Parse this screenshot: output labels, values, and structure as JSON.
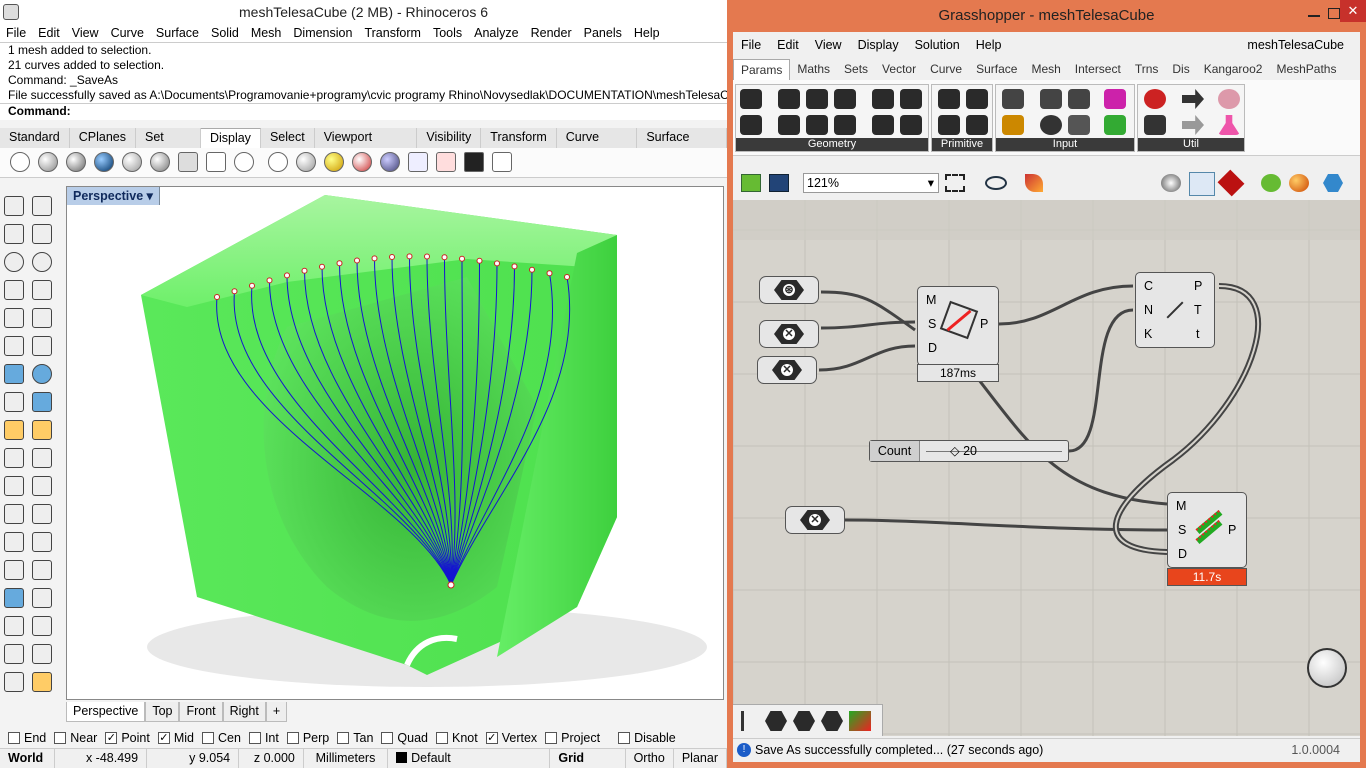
{
  "rhino": {
    "title": "meshTelesaCube (2 MB) - Rhinoceros 6",
    "menu": [
      "File",
      "Edit",
      "View",
      "Curve",
      "Surface",
      "Solid",
      "Mesh",
      "Dimension",
      "Transform",
      "Tools",
      "Analyze",
      "Render",
      "Panels",
      "Help"
    ],
    "command_history": [
      "1 mesh added to selection.",
      "21 curves added to selection.",
      "Command: _SaveAs",
      "File successfully saved as A:\\Documents\\Programovanie+programy\\cvic programy Rhino\\Novysedlak\\DOCUMENTATION\\meshTelesaCube"
    ],
    "command_prompt": "Command:",
    "tabs": [
      "Standard",
      "CPlanes",
      "Set View",
      "Display",
      "Select",
      "Viewport Layout",
      "Visibility",
      "Transform",
      "Curve Tools",
      "Surface Tools"
    ],
    "active_tab": "Display",
    "viewport_label": "Perspective",
    "viewport_tabs": [
      "Perspective",
      "Top",
      "Front",
      "Right"
    ],
    "viewport_add": "+",
    "osnaps": [
      {
        "label": "End",
        "checked": false
      },
      {
        "label": "Near",
        "checked": false
      },
      {
        "label": "Point",
        "checked": true
      },
      {
        "label": "Mid",
        "checked": true
      },
      {
        "label": "Cen",
        "checked": false
      },
      {
        "label": "Int",
        "checked": false
      },
      {
        "label": "Perp",
        "checked": false
      },
      {
        "label": "Tan",
        "checked": false
      },
      {
        "label": "Quad",
        "checked": false
      },
      {
        "label": "Knot",
        "checked": false
      },
      {
        "label": "Vertex",
        "checked": true
      },
      {
        "label": "Project",
        "checked": false
      },
      {
        "label": "Disable",
        "checked": false
      }
    ],
    "status": {
      "cplane": "World",
      "x": "x -48.499",
      "y": "y 9.054",
      "z": "z 0.000",
      "units": "Millimeters",
      "layer": "Default",
      "grid_snap": "Grid Snap",
      "ortho": "Ortho",
      "planar": "Planar"
    }
  },
  "grasshopper": {
    "title": "Grasshopper - meshTelesaCube",
    "menu": [
      "File",
      "Edit",
      "View",
      "Display",
      "Solution",
      "Help"
    ],
    "document_name": "meshTelesaCube",
    "tabs": [
      "Params",
      "Maths",
      "Sets",
      "Vector",
      "Curve",
      "Surface",
      "Mesh",
      "Intersect",
      "Trns",
      "Dis",
      "Kangaroo2",
      "MeshPaths"
    ],
    "active_tab": "Params",
    "groups": [
      "Geometry",
      "Primitive",
      "Input",
      "Util"
    ],
    "zoom": "121%",
    "component1": {
      "inputs": [
        "M",
        "S",
        "D"
      ],
      "output": "P",
      "time": "187ms"
    },
    "component2": {
      "inputs": [
        "C",
        "N",
        "K"
      ],
      "outputs": [
        "P",
        "T",
        "t"
      ]
    },
    "component3": {
      "inputs": [
        "M",
        "S",
        "D"
      ],
      "output": "P",
      "time": "11.7s"
    },
    "slider": {
      "label": "Count",
      "value": "20"
    },
    "status_message": "Save As successfully completed... (27 seconds ago)",
    "version": "1.0.0004",
    "colors": {
      "accent": "#e4794f",
      "warning": "#e8451c",
      "mesh": "#4de84d",
      "curve": "#1414d0"
    }
  }
}
